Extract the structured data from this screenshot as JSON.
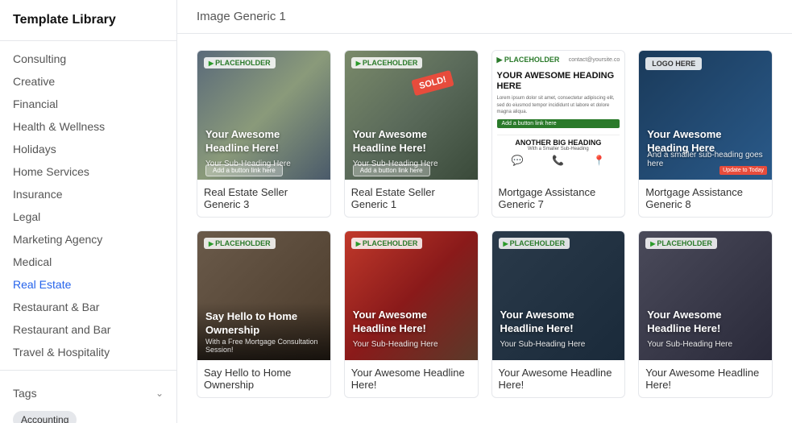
{
  "page": {
    "title": "Template Library"
  },
  "sidebar": {
    "nav_items": [
      {
        "label": "Consulting",
        "active": false
      },
      {
        "label": "Creative",
        "active": false
      },
      {
        "label": "Financial",
        "active": false
      },
      {
        "label": "Health & Wellness",
        "active": false
      },
      {
        "label": "Holidays",
        "active": false
      },
      {
        "label": "Home Services",
        "active": false
      },
      {
        "label": "Insurance",
        "active": false
      },
      {
        "label": "Legal",
        "active": false
      },
      {
        "label": "Marketing Agency",
        "active": false
      },
      {
        "label": "Medical",
        "active": false
      },
      {
        "label": "Real Estate",
        "active": true
      },
      {
        "label": "Restaurant & Bar",
        "active": false
      },
      {
        "label": "Restaurant and Bar",
        "active": false
      },
      {
        "label": "Travel & Hospitality",
        "active": false
      }
    ],
    "tags_label": "Tags",
    "tag_pill": "Accounting"
  },
  "main": {
    "header_title": "Image Generic 1",
    "templates": [
      {
        "id": 1,
        "name": "Real Estate Seller Generic 3",
        "img_type": "aerial",
        "overlay_heading": "Your Awesome Headline Here!",
        "overlay_sub": "Your Sub-Heading Here",
        "overlay_btn": "Add a button link here",
        "placeholder_label": "PLACEHOLDER"
      },
      {
        "id": 2,
        "name": "Real Estate Seller Generic 1",
        "img_type": "sold",
        "overlay_heading": "Your Awesome Headline Here!",
        "overlay_sub": "Your Sub-Heading Here",
        "overlay_btn": "Add a button link here",
        "placeholder_label": "PLACEHOLDER"
      },
      {
        "id": 3,
        "name": "Mortgage Assistance Generic 7",
        "img_type": "mortgage-light",
        "heading": "YOUR AWESOME HEADING HERE",
        "body": "Lorem ipsum dolor sit amet, consectetur adipiscing elit, sed do eiusmod tempor incididunt ut labore et dolore magna aliqua.",
        "btn_label": "Add a button link here",
        "second_heading": "ANOTHER BIG HEADING",
        "second_sub": "With a Smaller Sub-Heading",
        "placeholder_label": "PLACEHOLDER",
        "contact": "contact@yoursite.co"
      },
      {
        "id": 4,
        "name": "Mortgage Assistance Generic 8",
        "img_type": "man",
        "overlay_heading": "Your Awesome Heading Here",
        "overlay_sub": "And a smaller sub-heading goes here",
        "update_badge": "Update to Today",
        "placeholder_label": "LOGO HERE"
      },
      {
        "id": 5,
        "name": "Say Hello to Home Ownership",
        "img_type": "meeting",
        "overlay_heading": "Say Hello to Home Ownership",
        "overlay_sub": "With a Free Mortgage Consultation Session!",
        "placeholder_label": "PLACEHOLDER"
      },
      {
        "id": 6,
        "name": "Your Awesome Headline Here!",
        "img_type": "red-house",
        "overlay_heading": "Your Awesome Headline Here!",
        "overlay_sub": "Your Sub-Heading Here",
        "placeholder_label": "PLACEHOLDER"
      },
      {
        "id": 7,
        "name": "Your Awesome Headline Here!",
        "img_type": "dark-meeting",
        "overlay_heading": "Your Awesome Headline Here!",
        "overlay_sub": "Your Sub-Heading Here",
        "placeholder_label": "PLACEHOLDER"
      },
      {
        "id": 8,
        "name": "Your Awesome Headline Here!",
        "img_type": "tablet",
        "overlay_heading": "Your Awesome Headline Here!",
        "overlay_sub": "Your Sub-Heading Here",
        "placeholder_label": "PLACEHOLDER"
      }
    ]
  }
}
